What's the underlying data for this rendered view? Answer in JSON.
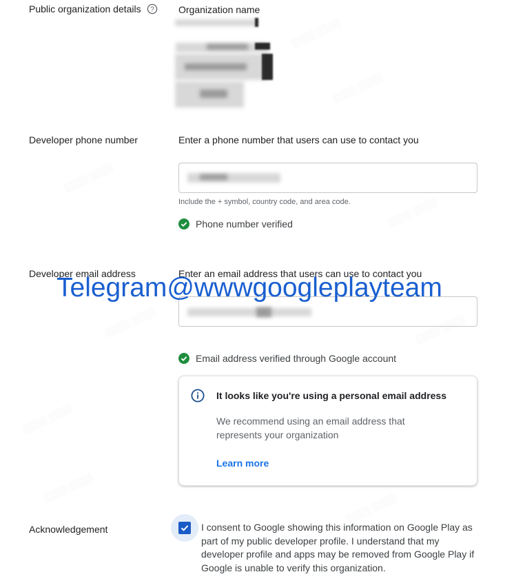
{
  "public_details": {
    "label": "Public organization details",
    "org_name_title": "Organization name"
  },
  "phone": {
    "label": "Developer phone number",
    "prompt": "Enter a phone number that users can use to contact you",
    "hint": "Include the + symbol, country code, and area code.",
    "verified_text": "Phone number verified"
  },
  "email": {
    "label": "Developer email address",
    "prompt": "Enter an email address that users can use to contact you",
    "verified_text": "Email address verified through Google account"
  },
  "info_card": {
    "title": "It looks like you're using a personal email address",
    "body": "We recommend using an email address that represents your organization",
    "link": "Learn more"
  },
  "acknowledgement": {
    "label": "Acknowledgement",
    "checked": true,
    "text": "I consent to Google showing this information on Google Play as part of my public developer profile. I understand that my developer profile and apps may be removed from Google Play if Google is unable to verify this organization."
  },
  "overlay": {
    "text": "Telegram@wwwgoogleplayteam"
  },
  "colors": {
    "accent": "#1a73e8",
    "verified_green": "#1e8e3e",
    "overlay_blue": "#1a5fd0"
  },
  "icons": [
    "help-icon",
    "check-circle-icon",
    "info-icon",
    "checkmark-icon"
  ]
}
